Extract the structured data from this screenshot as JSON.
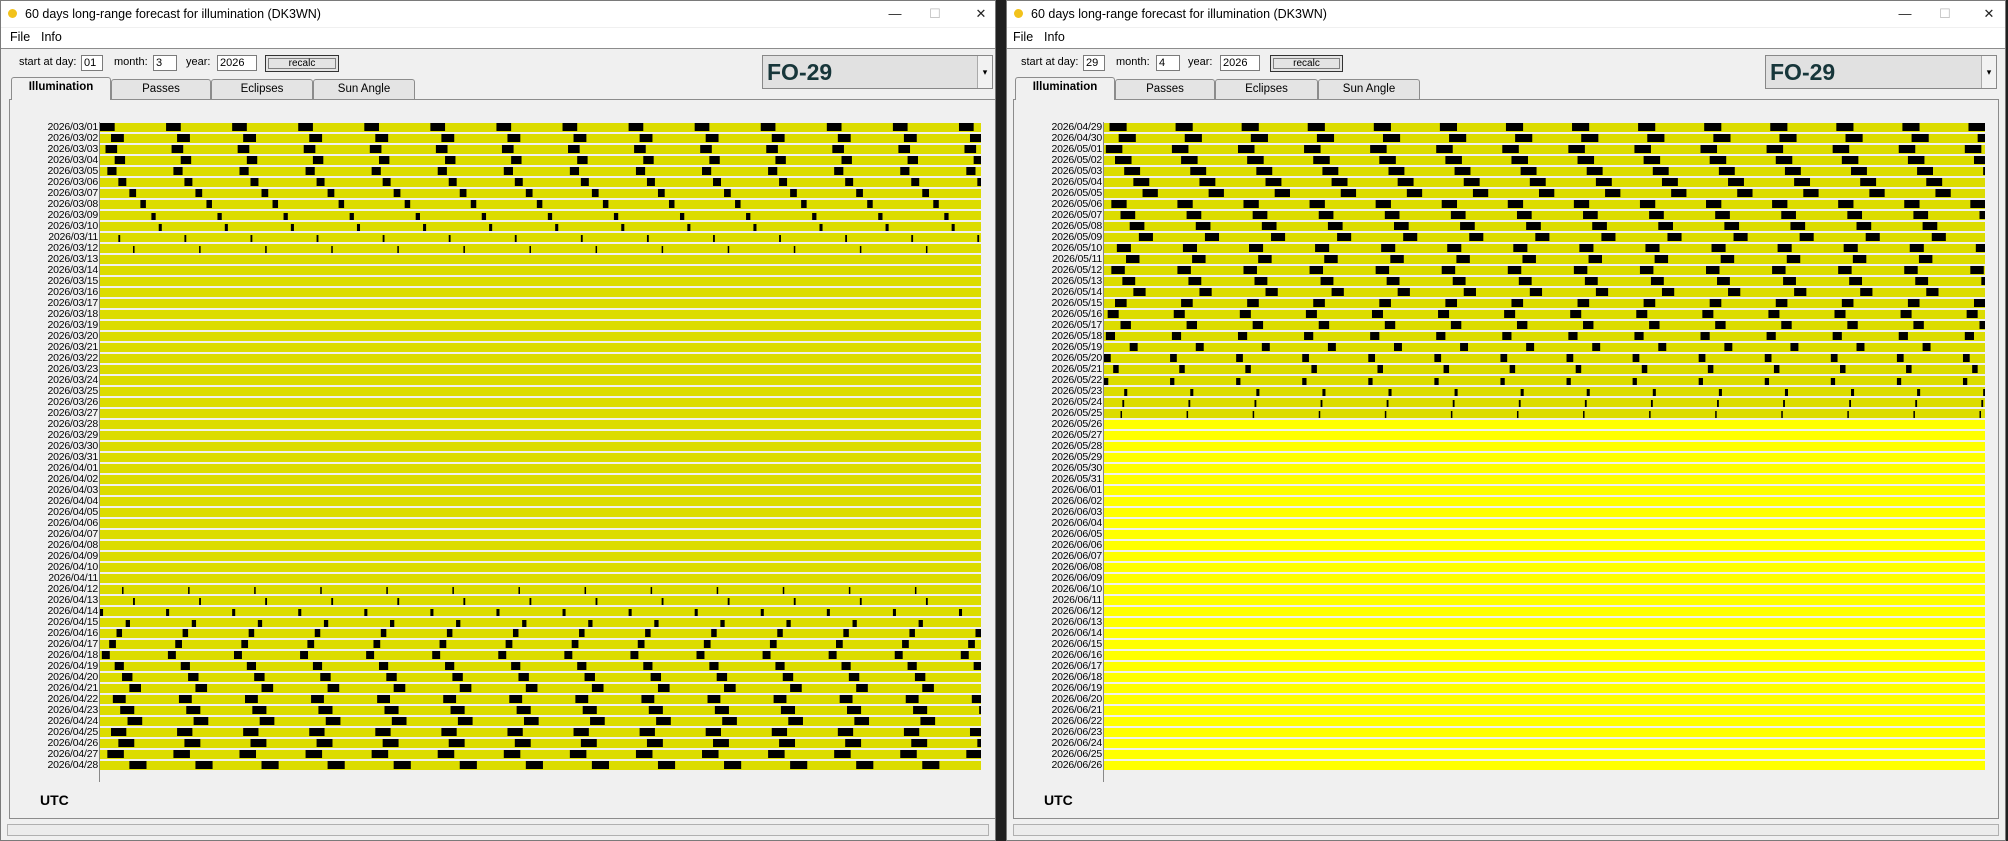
{
  "windows": [
    {
      "title": "60 days long-range forecast for illumination (DK3WN)",
      "caption": {
        "minimize": "—",
        "maximize": "☐",
        "close": "✕"
      },
      "menu": {
        "file": "File",
        "info": "Info"
      },
      "controls": {
        "day_label": "start at day:",
        "day_value": "01",
        "month_label": "month:",
        "month_value": "3",
        "year_label": "year:",
        "year_value": "2026",
        "recalc_label": "recalc"
      },
      "satellite": "FO-29",
      "dropdown_arrow": "▾",
      "tabs": [
        "Illumination",
        "Passes",
        "Eclipses",
        "Sun Angle"
      ],
      "active_tab": "Illumination",
      "timezone": "UTC",
      "colors": {
        "sunlit": "#ffff00",
        "sunlit_dark": "#dcdc00",
        "eclipse": "#000000"
      },
      "chart_data": {
        "type": "heatmap",
        "title": "60 days long-range forecast for illumination (DK3WN)",
        "rows": [
          "2026/03/01",
          "2026/03/02",
          "2026/03/03",
          "2026/03/04",
          "2026/03/05",
          "2026/03/06",
          "2026/03/07",
          "2026/03/08",
          "2026/03/09",
          "2026/03/10",
          "2026/03/11",
          "2026/03/12",
          "2026/03/13",
          "2026/03/14",
          "2026/03/15",
          "2026/03/16",
          "2026/03/17",
          "2026/03/18",
          "2026/03/19",
          "2026/03/20",
          "2026/03/21",
          "2026/03/22",
          "2026/03/23",
          "2026/03/24",
          "2026/03/25",
          "2026/03/26",
          "2026/03/27",
          "2026/03/28",
          "2026/03/29",
          "2026/03/30",
          "2026/03/31",
          "2026/04/01",
          "2026/04/02",
          "2026/04/03",
          "2026/04/04",
          "2026/04/05",
          "2026/04/06",
          "2026/04/07",
          "2026/04/08",
          "2026/04/09",
          "2026/04/10",
          "2026/04/11",
          "2026/04/12",
          "2026/04/13",
          "2026/04/14",
          "2026/04/15",
          "2026/04/16",
          "2026/04/17",
          "2026/04/18",
          "2026/04/19",
          "2026/04/20",
          "2026/04/21",
          "2026/04/22",
          "2026/04/23",
          "2026/04/24",
          "2026/04/25",
          "2026/04/26",
          "2026/04/27",
          "2026/04/28"
        ],
        "hours_per_row": 24,
        "orbit_period_hours": 1.8,
        "eclipse_minutes": [
          24,
          21,
          19,
          17,
          15,
          13,
          11,
          9,
          7,
          5,
          3,
          1,
          0,
          0,
          0,
          0,
          0,
          0,
          0,
          0,
          0,
          0,
          0,
          0,
          0,
          0,
          0,
          0,
          0,
          0,
          0,
          0,
          0,
          0,
          0,
          0,
          0,
          0,
          0,
          0,
          0,
          0,
          1,
          3,
          5,
          7,
          9,
          11,
          13,
          15,
          17,
          19,
          21,
          23,
          24,
          25,
          26,
          27,
          28
        ],
        "eclipse_start_hour": [
          0,
          0.3,
          0.15,
          0.4,
          0.2,
          0.5,
          0.8,
          1.1,
          1.4,
          1.6,
          0.5,
          0.9,
          0,
          0,
          0,
          0,
          0,
          0,
          0,
          0,
          0,
          0,
          0,
          0,
          0,
          0,
          0,
          0,
          0,
          0,
          0,
          0,
          0,
          0,
          0,
          0,
          0,
          0,
          0,
          0,
          0,
          0,
          0.6,
          0.9,
          0,
          0.7,
          0.45,
          0.25,
          0.05,
          0.4,
          0.6,
          0.8,
          0.35,
          0.55,
          0.75,
          0.3,
          0.5,
          0.2,
          0.8
        ]
      }
    },
    {
      "title": "60 days long-range forecast for illumination (DK3WN)",
      "caption": {
        "minimize": "—",
        "maximize": "☐",
        "close": "✕"
      },
      "menu": {
        "file": "File",
        "info": "Info"
      },
      "controls": {
        "day_label": "start at day:",
        "day_value": "29",
        "month_label": "month:",
        "month_value": "4",
        "year_label": "year:",
        "year_value": "2026",
        "recalc_label": "recalc"
      },
      "satellite": "FO-29",
      "dropdown_arrow": "▾",
      "tabs": [
        "Illumination",
        "Passes",
        "Eclipses",
        "Sun Angle"
      ],
      "active_tab": "Illumination",
      "timezone": "UTC",
      "colors": {
        "sunlit": "#ffff00",
        "sunlit_dark": "#dcdc00",
        "eclipse": "#000000"
      },
      "chart_data": {
        "type": "heatmap",
        "title": "60 days long-range forecast for illumination (DK3WN)",
        "rows": [
          "2026/04/29",
          "2026/04/30",
          "2026/05/01",
          "2026/05/02",
          "2026/05/03",
          "2026/05/04",
          "2026/05/05",
          "2026/05/06",
          "2026/05/07",
          "2026/05/08",
          "2026/05/09",
          "2026/05/10",
          "2026/05/11",
          "2026/05/12",
          "2026/05/13",
          "2026/05/14",
          "2026/05/15",
          "2026/05/16",
          "2026/05/17",
          "2026/05/18",
          "2026/05/19",
          "2026/05/20",
          "2026/05/21",
          "2026/05/22",
          "2026/05/23",
          "2026/05/24",
          "2026/05/25",
          "2026/05/26",
          "2026/05/27",
          "2026/05/28",
          "2026/05/29",
          "2026/05/30",
          "2026/05/31",
          "2026/06/01",
          "2026/06/02",
          "2026/06/03",
          "2026/06/04",
          "2026/06/05",
          "2026/06/06",
          "2026/06/07",
          "2026/06/08",
          "2026/06/09",
          "2026/06/10",
          "2026/06/11",
          "2026/06/12",
          "2026/06/13",
          "2026/06/14",
          "2026/06/15",
          "2026/06/16",
          "2026/06/17",
          "2026/06/18",
          "2026/06/19",
          "2026/06/20",
          "2026/06/21",
          "2026/06/22",
          "2026/06/23",
          "2026/06/24",
          "2026/06/25",
          "2026/06/26"
        ],
        "hours_per_row": 24,
        "orbit_period_hours": 1.8,
        "eclipse_minutes": [
          28,
          28,
          27,
          27,
          26,
          26,
          25,
          25,
          24,
          24,
          23,
          23,
          22,
          22,
          21,
          20,
          19,
          18,
          17,
          15,
          13,
          11,
          9,
          7,
          5,
          3,
          1,
          0,
          0,
          0,
          0,
          0,
          0,
          0,
          0,
          0,
          0,
          0,
          0,
          0,
          0,
          0,
          0,
          0,
          0,
          0,
          0,
          0,
          0,
          0,
          0,
          0,
          0,
          0,
          0,
          0,
          0,
          0,
          0
        ],
        "eclipse_start_hour": [
          0.15,
          0.4,
          0.05,
          0.3,
          0.55,
          0.8,
          1.05,
          0.2,
          0.45,
          0.7,
          0.95,
          0.35,
          0.6,
          0.2,
          0.5,
          0.8,
          0.3,
          0.1,
          0.45,
          0.05,
          0.7,
          0.0,
          0.25,
          0.0,
          0.55,
          0.5,
          0.45,
          0,
          0,
          0,
          0,
          0,
          0,
          0,
          0,
          0,
          0,
          0,
          0,
          0,
          0,
          0,
          0,
          0,
          0,
          0,
          0,
          0,
          0,
          0,
          0,
          0,
          0,
          0,
          0,
          0,
          0,
          0,
          0
        ]
      }
    }
  ]
}
